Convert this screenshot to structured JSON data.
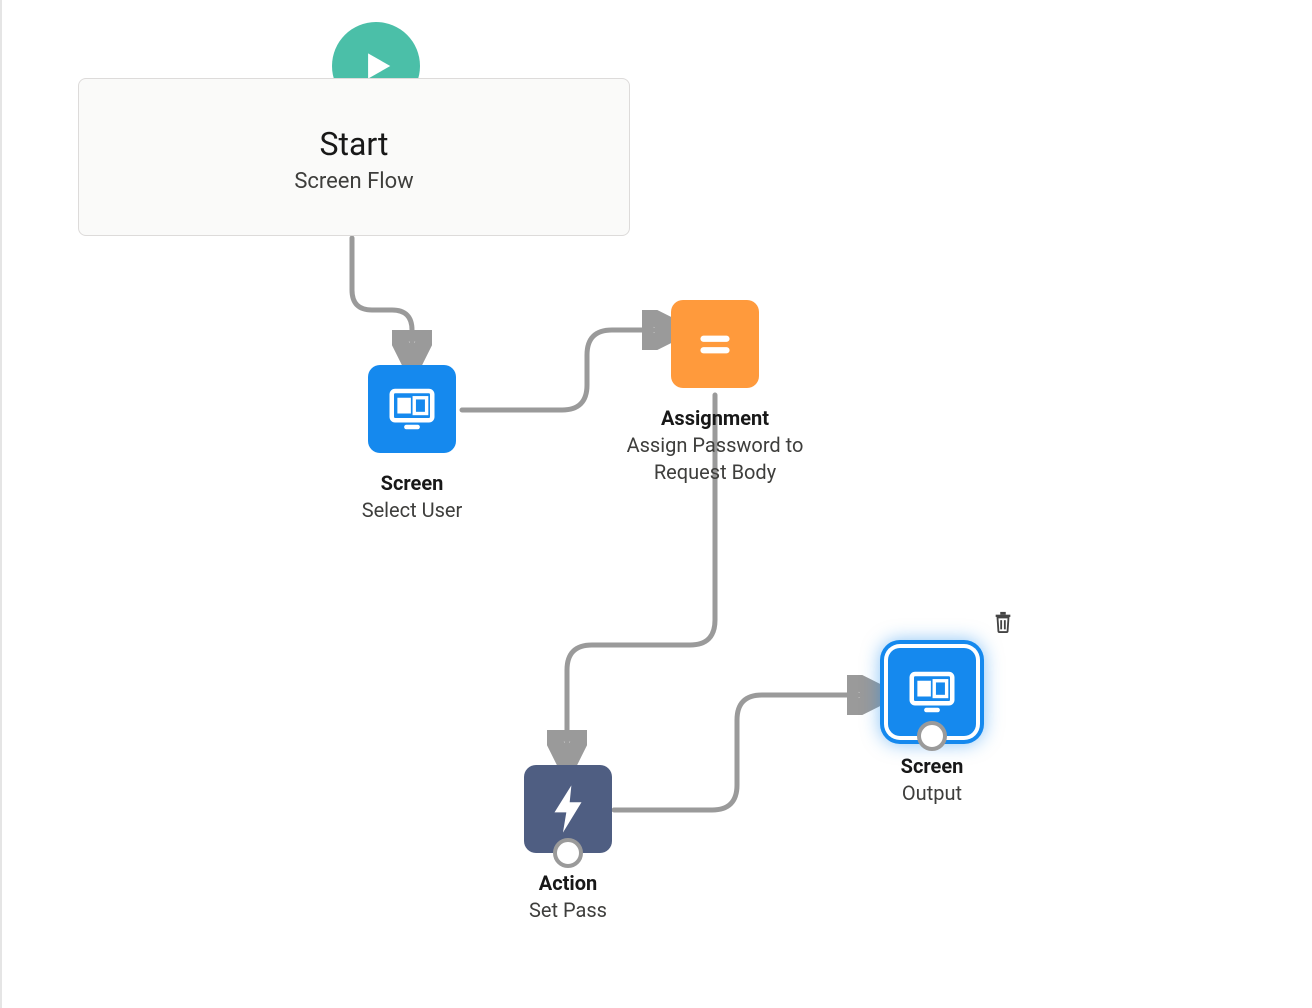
{
  "start": {
    "title": "Start",
    "subtitle": "Screen Flow"
  },
  "nodes": {
    "screen1": {
      "type": "Screen",
      "label": "Select User"
    },
    "assignment": {
      "type": "Assignment",
      "label": "Assign Password to Request Body"
    },
    "action": {
      "type": "Action",
      "label": "Set Pass"
    },
    "screen2": {
      "type": "Screen",
      "label": "Output"
    }
  },
  "icons": {
    "play": "play-icon",
    "screen": "screen-icon",
    "assign": "equals-icon",
    "action": "bolt-icon",
    "trash": "trash-icon"
  }
}
